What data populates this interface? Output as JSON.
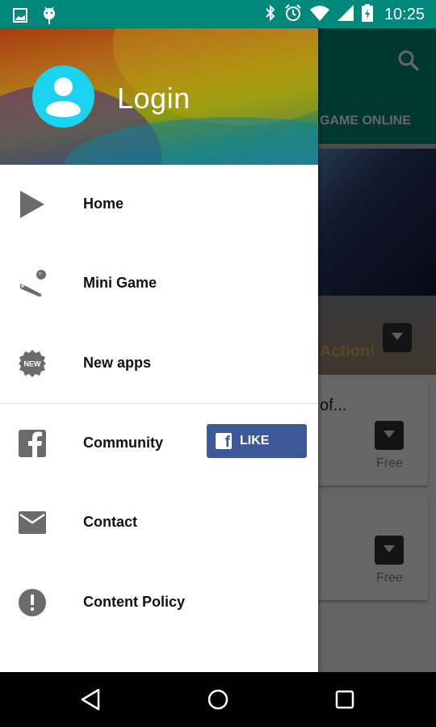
{
  "status_bar": {
    "time": "10:25",
    "left_icons": [
      "image-notification-icon",
      "android-notification-icon"
    ],
    "right_icons": [
      "bluetooth-icon",
      "alarm-icon",
      "wifi-icon",
      "cell-signal-icon",
      "battery-charging-icon"
    ]
  },
  "drawer": {
    "header": {
      "login_label": "Login"
    },
    "items": [
      {
        "label": "Home",
        "icon": "play-icon"
      },
      {
        "label": "Mini Game",
        "icon": "pinball-icon"
      },
      {
        "label": "New apps",
        "icon": "new-badge-icon",
        "icon_text": "NEW"
      },
      {
        "label": "Community",
        "icon": "facebook-icon"
      },
      {
        "label": "Contact",
        "icon": "mail-icon"
      },
      {
        "label": "Content Policy",
        "icon": "alert-circle-icon"
      }
    ],
    "like_button": {
      "label": "LIKE",
      "icon_text": "f",
      "color": "#3b5998"
    }
  },
  "background_app": {
    "tab_label": "GAME ONLINE",
    "banner_text": "Action!",
    "cards": [
      {
        "title": "of...",
        "price": "Free"
      },
      {
        "title": "",
        "price": "Free"
      }
    ],
    "accent_color": "#00897b"
  },
  "nav_bar": {
    "buttons": [
      "back",
      "home",
      "recents"
    ]
  }
}
